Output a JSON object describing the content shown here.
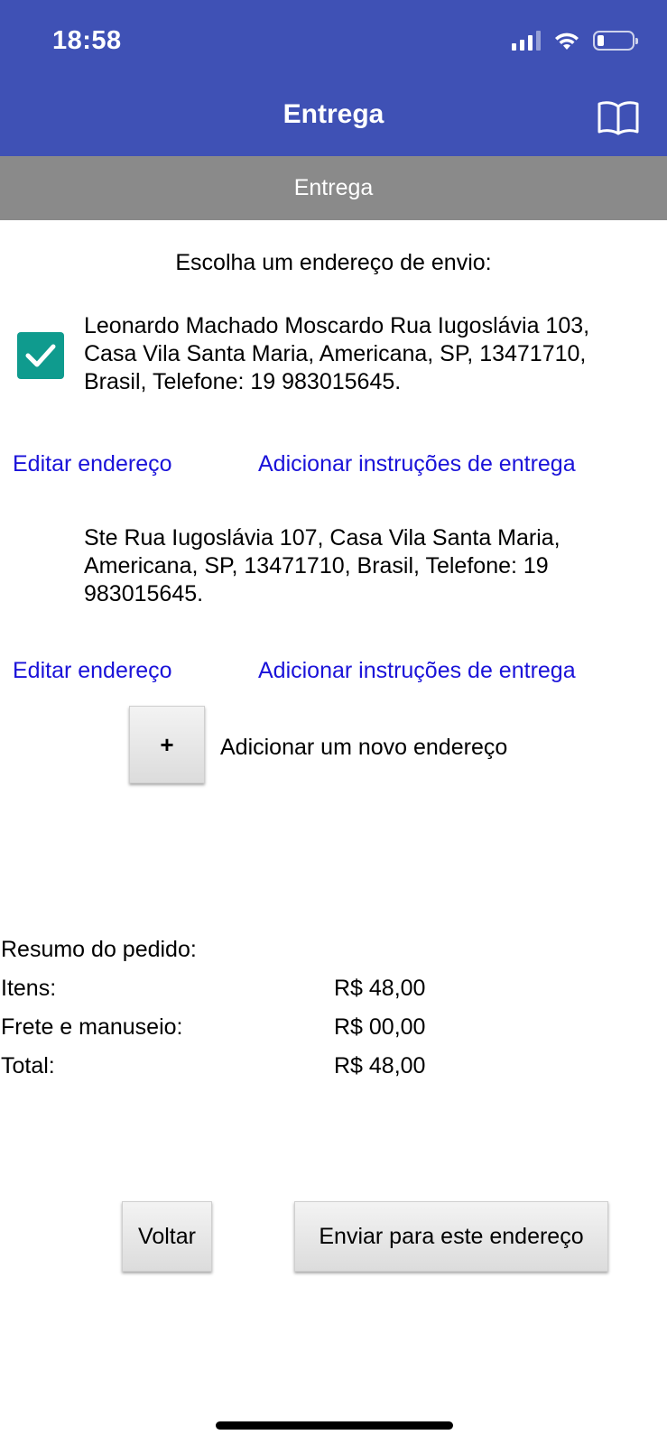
{
  "status_bar": {
    "time": "18:58"
  },
  "header": {
    "title": "Entrega",
    "subtitle": "Entrega"
  },
  "prompt": "Escolha um endereço de envio:",
  "addresses": [
    {
      "text": "Leonardo Machado Moscardo Rua Iugoslávia 103, Casa Vila Santa Maria, Americana, SP, 13471710, Brasil, Telefone: 19 983015645.",
      "selected": true,
      "edit_label": "Editar endereço",
      "instructions_label": "Adicionar instruções de entrega"
    },
    {
      "text": "Ste Rua Iugoslávia 107, Casa Vila Santa Maria, Americana, SP, 13471710, Brasil, Telefone: 19 983015645.",
      "selected": false,
      "edit_label": "Editar endereço",
      "instructions_label": "Adicionar instruções de entrega"
    }
  ],
  "add_address": {
    "button_label": "+",
    "label": "Adicionar um novo endereço"
  },
  "summary": {
    "title": "Resumo do pedido:",
    "rows": [
      {
        "label": "Itens:",
        "value": "R$ 48,00"
      },
      {
        "label": "Frete e manuseio:",
        "value": "R$ 00,00"
      },
      {
        "label": "Total:",
        "value": "R$ 48,00"
      }
    ]
  },
  "actions": {
    "back_label": "Voltar",
    "send_label": "Enviar para este endereço"
  },
  "colors": {
    "header": "#3f51b5",
    "subheader": "#8a8a8a",
    "checkbox": "#0f9b8e",
    "link": "#1a12d9"
  }
}
